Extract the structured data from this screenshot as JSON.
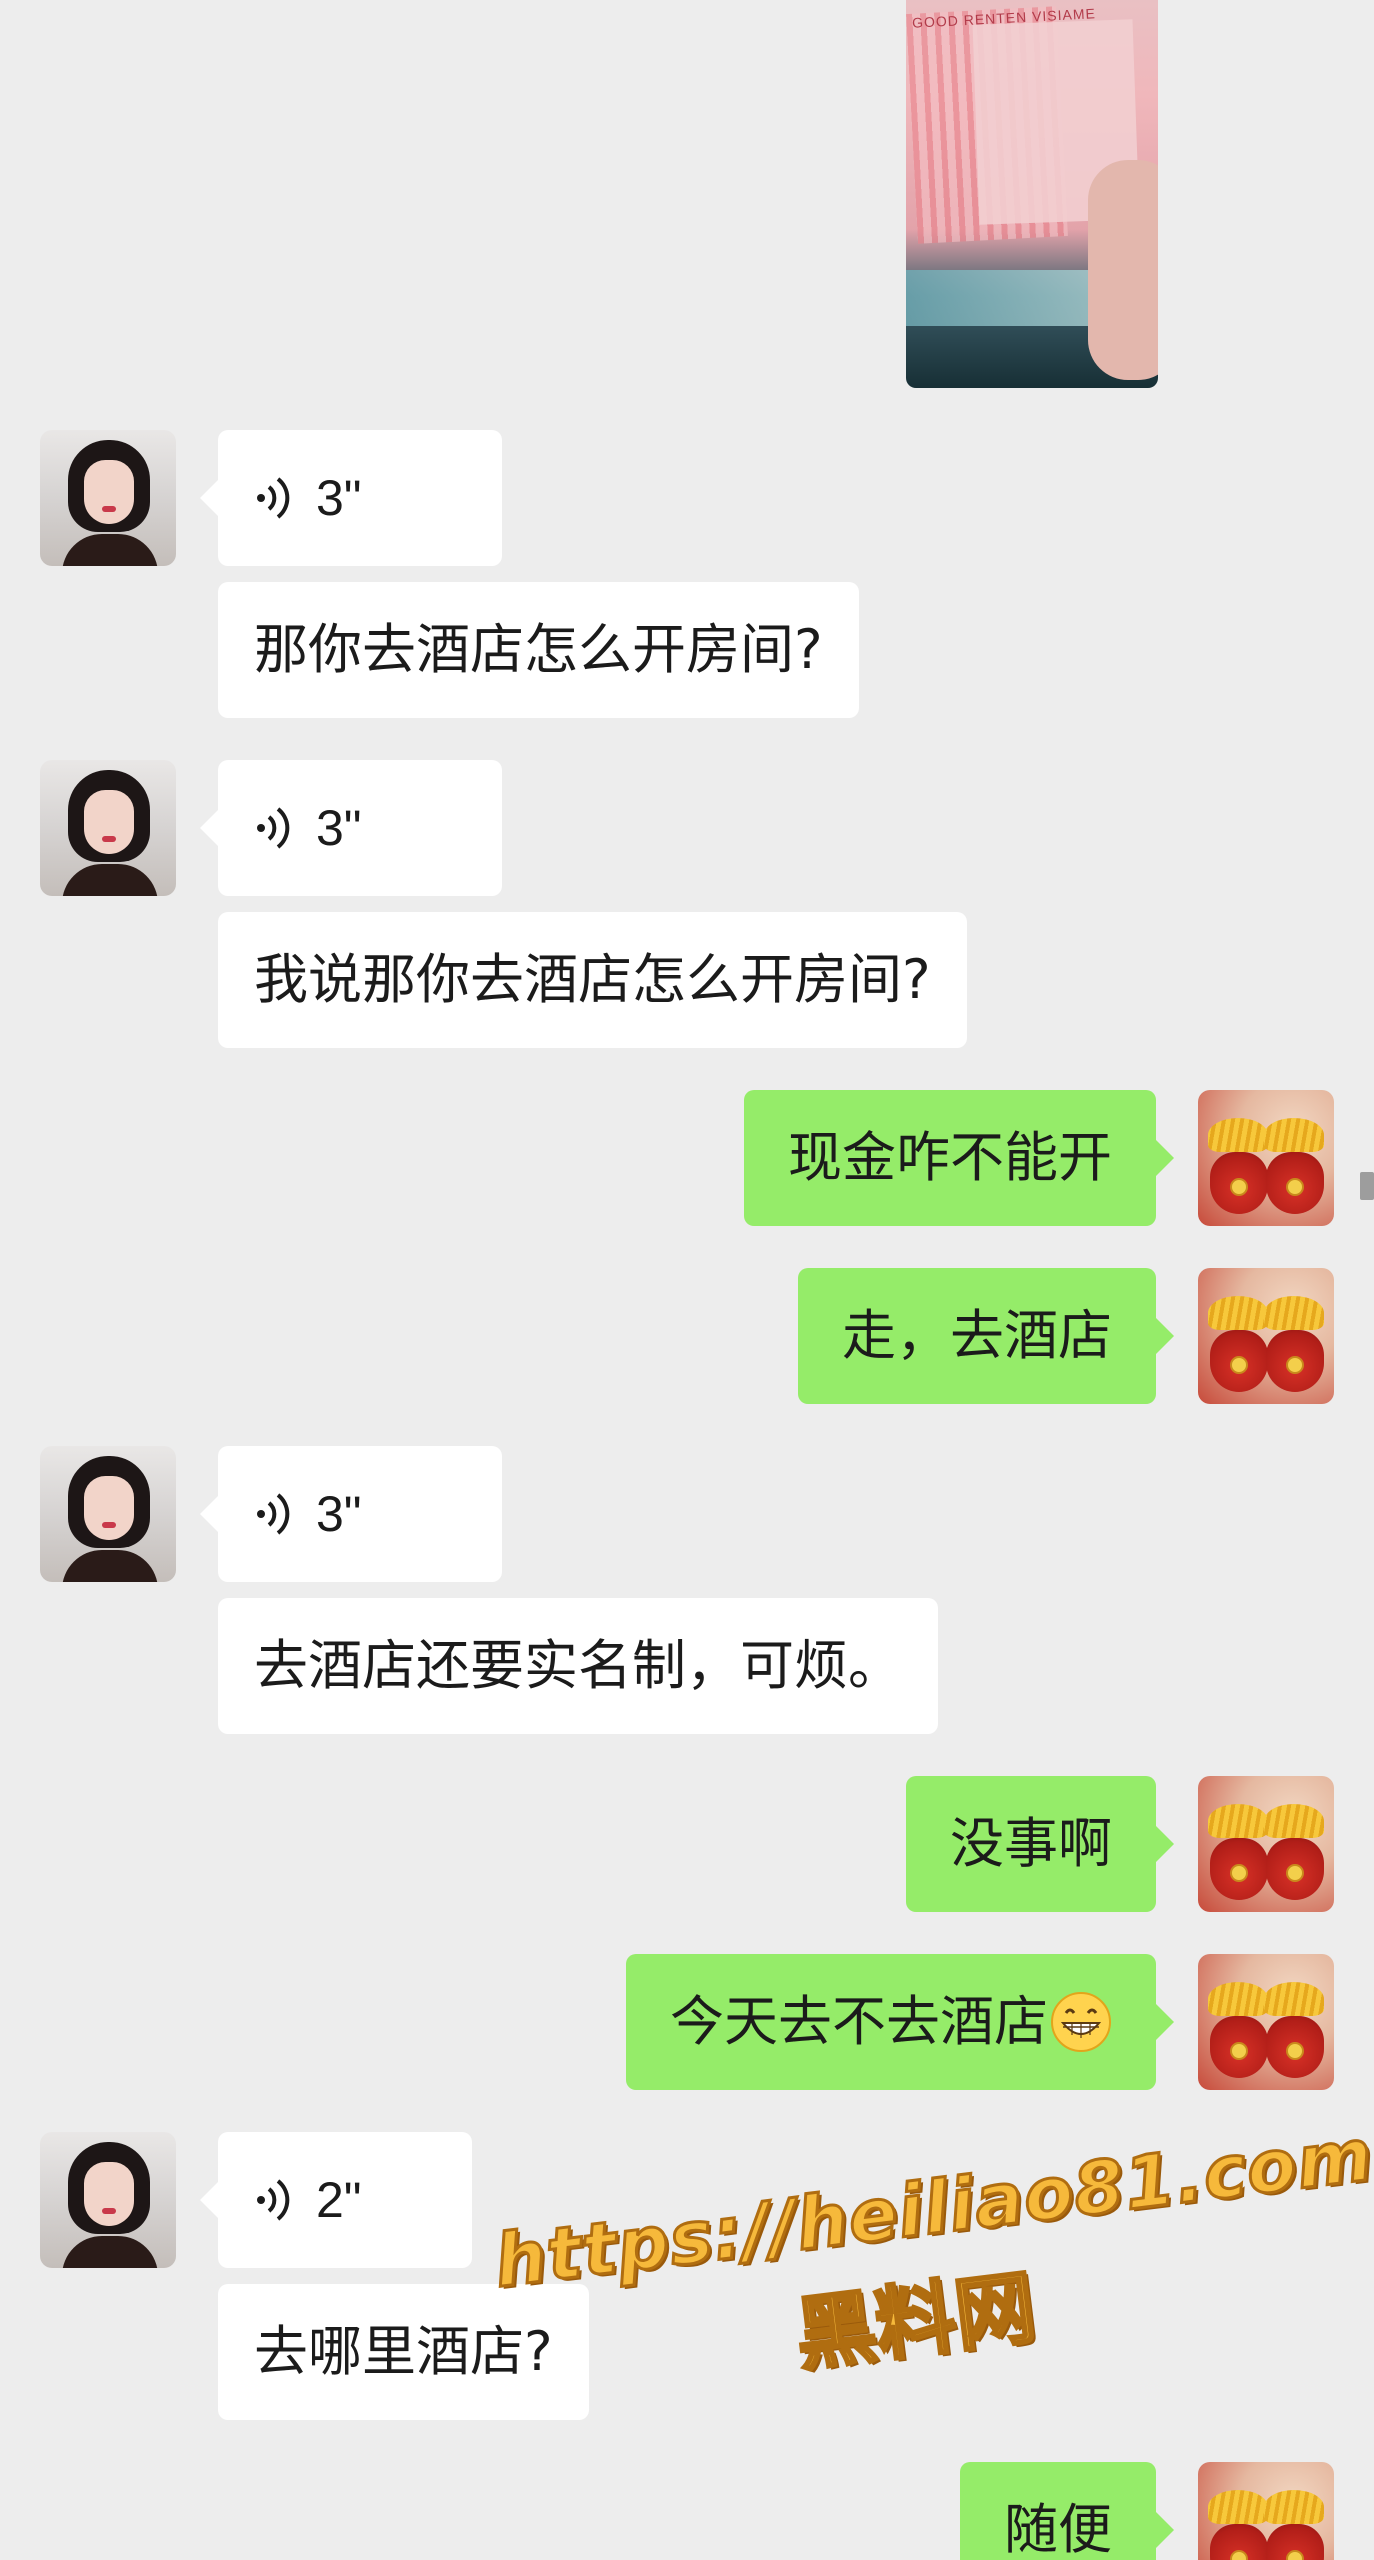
{
  "photo": {
    "banner_text": "GOOD RENTEN VISIAME"
  },
  "messages": [
    {
      "sender": "them",
      "type": "voice",
      "duration": "3\""
    },
    {
      "sender": "them",
      "type": "text",
      "text": "那你去酒店怎么开房间?"
    },
    {
      "sender": "them",
      "type": "voice",
      "duration": "3\""
    },
    {
      "sender": "them",
      "type": "text",
      "text": "我说那你去酒店怎么开房间?"
    },
    {
      "sender": "me",
      "type": "text",
      "text": "现金咋不能开"
    },
    {
      "sender": "me",
      "type": "text",
      "text": "走，去酒店"
    },
    {
      "sender": "them",
      "type": "voice",
      "duration": "3\""
    },
    {
      "sender": "them",
      "type": "text",
      "text": "去酒店还要实名制，可烦。"
    },
    {
      "sender": "me",
      "type": "text",
      "text": "没事啊"
    },
    {
      "sender": "me",
      "type": "text",
      "text": "今天去不去酒店",
      "emoji": "grinning-face"
    },
    {
      "sender": "them",
      "type": "voice",
      "duration": "2\""
    },
    {
      "sender": "them",
      "type": "text",
      "text": "去哪里酒店?"
    },
    {
      "sender": "me",
      "type": "text",
      "text": "随便"
    }
  ],
  "watermark": {
    "url": "https://heiliao81.com",
    "name": "黑料网"
  },
  "colors": {
    "background": "#ededed",
    "incoming_bubble": "#ffffff",
    "outgoing_bubble": "#95ec69",
    "watermark": "#f6b93b"
  }
}
